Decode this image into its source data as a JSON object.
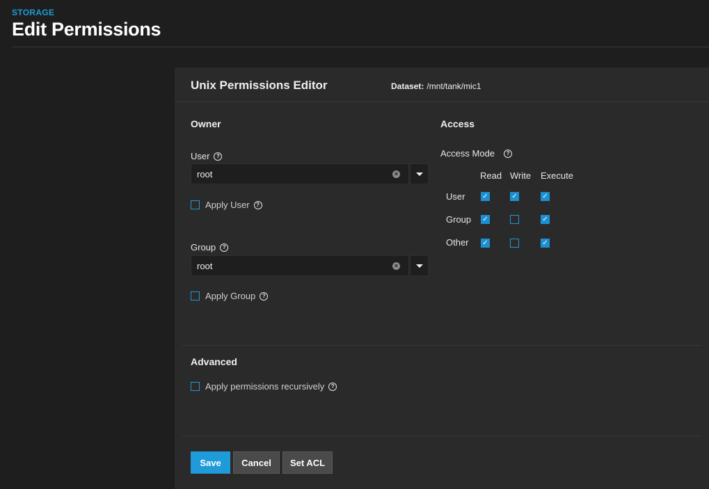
{
  "header": {
    "breadcrumb": "STORAGE",
    "title": "Edit Permissions"
  },
  "editor": {
    "title": "Unix Permissions Editor",
    "dataset_label": "Dataset:",
    "dataset_value": "/mnt/tank/mic1"
  },
  "owner": {
    "section_title": "Owner",
    "user_label": "User",
    "user_value": "root",
    "apply_user_label": "Apply User",
    "apply_user_checked": false,
    "group_label": "Group",
    "group_value": "root",
    "apply_group_label": "Apply Group",
    "apply_group_checked": false
  },
  "access": {
    "section_title": "Access",
    "mode_label": "Access Mode",
    "columns": [
      "Read",
      "Write",
      "Execute"
    ],
    "rows": [
      {
        "label": "User",
        "read": true,
        "write": true,
        "execute": true
      },
      {
        "label": "Group",
        "read": true,
        "write": false,
        "execute": true
      },
      {
        "label": "Other",
        "read": true,
        "write": false,
        "execute": true
      }
    ]
  },
  "advanced": {
    "section_title": "Advanced",
    "recursive_label": "Apply permissions recursively",
    "recursive_checked": false
  },
  "actions": {
    "save": "Save",
    "cancel": "Cancel",
    "set_acl": "Set ACL"
  },
  "icons": {
    "help": "help-circle-icon",
    "clear": "clear-icon",
    "dropdown": "chevron-down-icon",
    "check": "check-icon"
  },
  "colors": {
    "accent": "#1e9bd8",
    "background": "#1e1e1e",
    "card": "#2a2a2a"
  }
}
